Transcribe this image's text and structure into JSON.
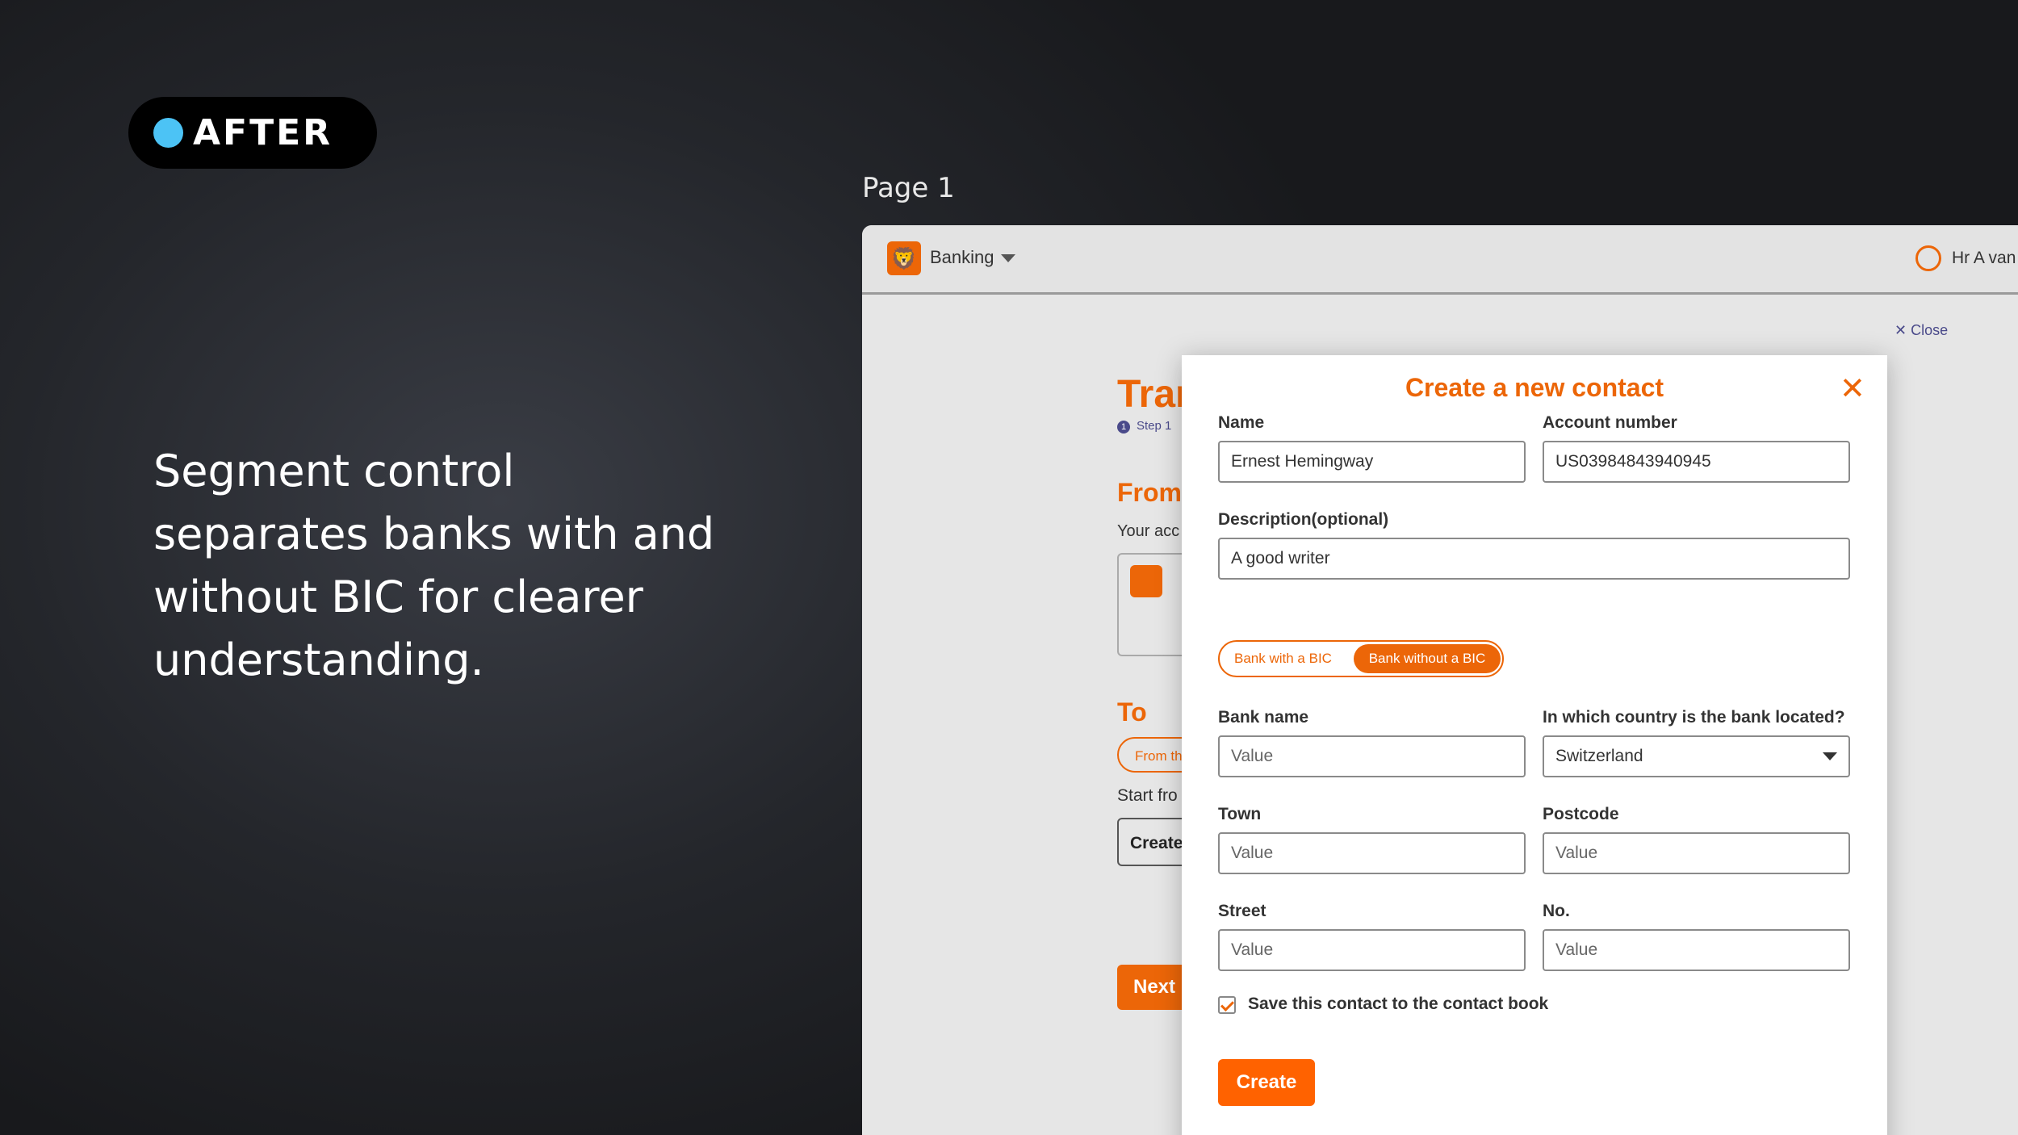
{
  "badge": {
    "label": "AFTER"
  },
  "headline": "Segment control separates banks with and without BIC for clearer understanding.",
  "page_label": "Page 1",
  "app": {
    "topbar": {
      "product": "Banking",
      "user": "Hr A van"
    },
    "close_label": "✕ Close",
    "background": {
      "title": "Tran",
      "step": "Step 1",
      "from": "From",
      "your_account": "Your acc",
      "to": "To",
      "from_the": "From th",
      "start_from": "Start fro",
      "create": "Create",
      "next": "Next"
    }
  },
  "modal": {
    "title": "Create a new contact",
    "name_label": "Name",
    "name_value": "Ernest Hemingway",
    "account_label": "Account number",
    "account_value": "US03984843940945",
    "description_label": "Description(optional)",
    "description_value": "A good writer",
    "segment": {
      "option1": "Bank with a BIC",
      "option2": "Bank without a BIC",
      "selected": "Bank without a BIC"
    },
    "bank_name_label": "Bank name",
    "bank_name_value": "Value",
    "country_label": "In which country is the bank located?",
    "country_value": "Switzerland",
    "town_label": "Town",
    "town_value": "Value",
    "postcode_label": "Postcode",
    "postcode_value": "Value",
    "street_label": "Street",
    "street_value": "Value",
    "number_label": "No.",
    "number_value": "Value",
    "save_contact_label": "Save this contact to the contact book",
    "save_contact_checked": true,
    "create_label": "Create"
  },
  "colors": {
    "accent": "#ec6608",
    "segment_active": "#ec6608",
    "badge_dot": "#4cc3f5"
  }
}
